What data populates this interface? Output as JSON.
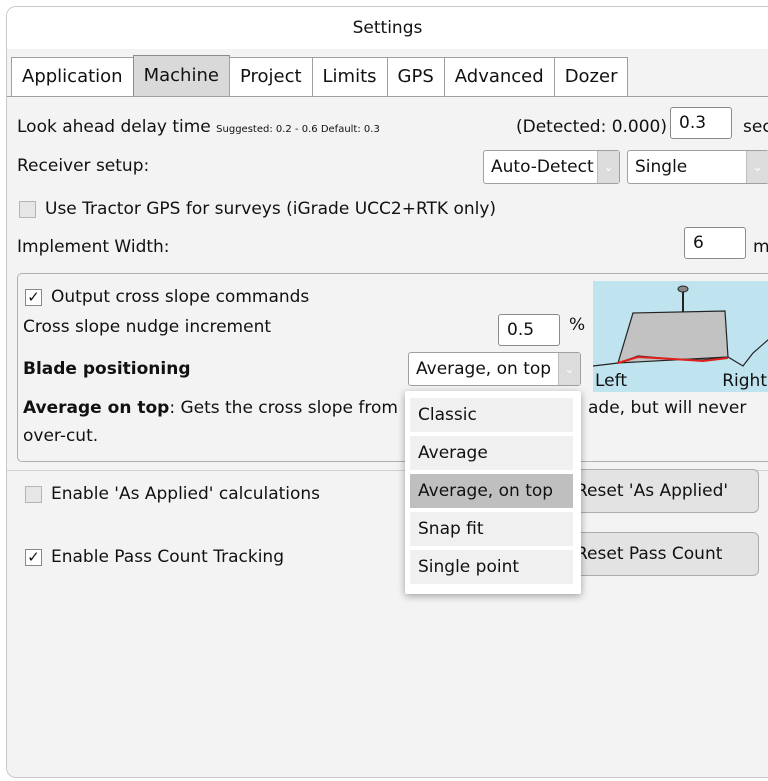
{
  "window": {
    "title": "Settings"
  },
  "tabs": [
    {
      "label": "Application",
      "active": false
    },
    {
      "label": "Machine",
      "active": true
    },
    {
      "label": "Project",
      "active": false
    },
    {
      "label": "Limits",
      "active": false
    },
    {
      "label": "GPS",
      "active": false
    },
    {
      "label": "Advanced",
      "active": false
    },
    {
      "label": "Dozer",
      "active": false
    }
  ],
  "lookahead": {
    "label": "Look ahead delay time",
    "hint": "Suggested: 0.2 - 0.6 Default: 0.3",
    "detected": "(Detected: 0.000)",
    "value": "0.3",
    "unit": "sec"
  },
  "receiver": {
    "label": "Receiver setup:",
    "mode": "Auto-Detect",
    "type": "Single"
  },
  "tractor_gps": {
    "label": "Use Tractor GPS for surveys (iGrade UCC2+RTK only)",
    "checked": false
  },
  "implement": {
    "label": "Implement Width:",
    "value": "6",
    "unit": "m"
  },
  "cross_slope": {
    "output_label": "Output cross slope commands",
    "output_checked": true,
    "nudge_label": "Cross slope nudge increment",
    "nudge_value": "0.5",
    "nudge_unit": "%",
    "blade_label": "Blade positioning",
    "blade_selected": "Average, on top",
    "desc_bold": "Average on top",
    "desc_part1": ": Gets the cross slope from ",
    "desc_part2": "ade, but will never",
    "desc_line2": "over-cut.",
    "diagram_left": "Left",
    "diagram_right": "Right"
  },
  "as_applied": {
    "label": "Enable 'As Applied' calculations",
    "checked": false,
    "button": "Reset 'As Applied'"
  },
  "pass_count": {
    "label": "Enable Pass Count Tracking",
    "checked": true,
    "button": "Reset Pass Count"
  },
  "dropdown": {
    "options": [
      "Classic",
      "Average",
      "Average, on top",
      "Snap fit",
      "Single point"
    ],
    "selected_index": 2
  },
  "colors": {
    "diagram_bg": "#bfe4ef",
    "blade": "#c2c2c2",
    "cut_line": "#e0201b",
    "selected_option": "#bfbfbf"
  }
}
